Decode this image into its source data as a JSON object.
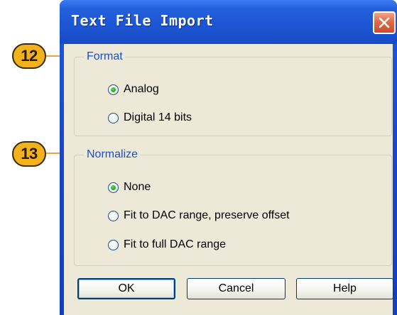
{
  "window": {
    "title": "Text File Import",
    "close_label": "close"
  },
  "format": {
    "title": "Format",
    "options": [
      {
        "label": "Analog",
        "checked": true
      },
      {
        "label": "Digital 14 bits",
        "checked": false
      }
    ]
  },
  "normalize": {
    "title": "Normalize",
    "options": [
      {
        "label": "None",
        "checked": true
      },
      {
        "label": "Fit to DAC range, preserve offset",
        "checked": false
      },
      {
        "label": "Fit to full DAC range",
        "checked": false
      }
    ]
  },
  "buttons": {
    "ok": "OK",
    "cancel": "Cancel",
    "help": "Help"
  },
  "callouts": {
    "format": "12",
    "normalize": "13"
  },
  "colors": {
    "titlebar": "#1d56d4",
    "dialog_bg": "#ece9d8",
    "group_title": "#1c4fd0",
    "close_button": "#e06a48",
    "callout_fill": "#f2b21e",
    "leader_line": "#e8a53a",
    "radio_checked": "#21a121"
  },
  "icons": {
    "close": "close-icon"
  }
}
